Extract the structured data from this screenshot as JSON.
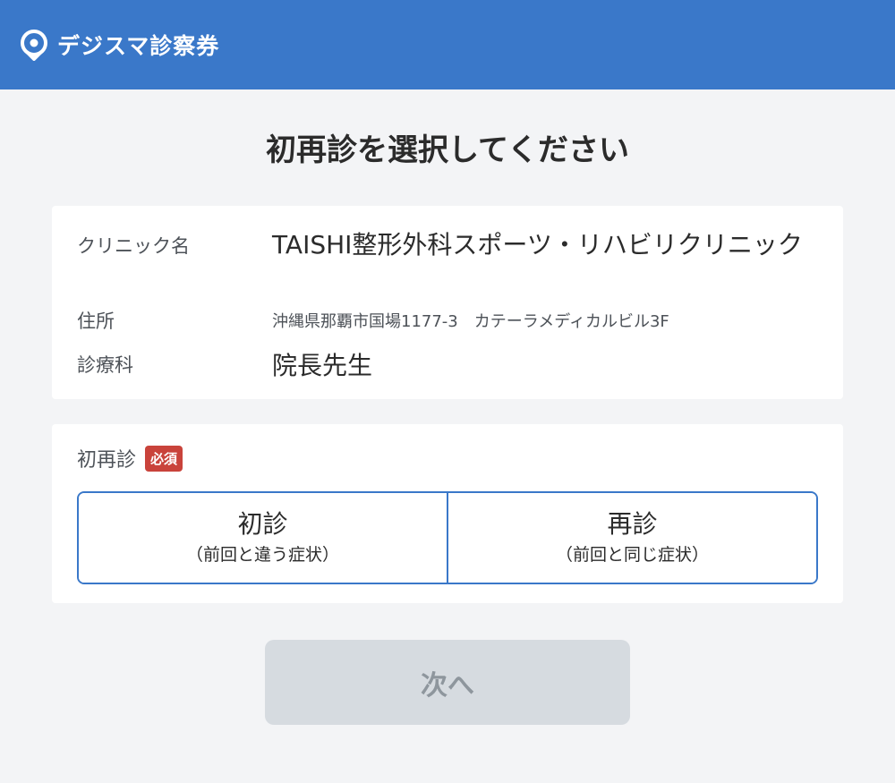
{
  "header": {
    "logo_icon": "location-pin-icon",
    "app_name": "デジスマ診察券",
    "brand_color": "#3a78c9"
  },
  "page": {
    "title": "初再診を選択してください"
  },
  "clinic": {
    "name_label": "クリニック名",
    "name_value": "TAISHI整形外科スポーツ・リハビリクリニック",
    "address_label": "住所",
    "address_value": "沖縄県那覇市国場1177-3　カテーラメディカルビル3F",
    "department_label": "診療科",
    "department_value": "院長先生"
  },
  "visit_type": {
    "label": "初再診",
    "required_badge": "必須",
    "required_color": "#c9433b",
    "options": [
      {
        "main": "初診",
        "sub": "（前回と違う症状）"
      },
      {
        "main": "再診",
        "sub": "（前回と同じ症状）"
      }
    ]
  },
  "actions": {
    "next_label": "次へ",
    "next_disabled": true
  }
}
